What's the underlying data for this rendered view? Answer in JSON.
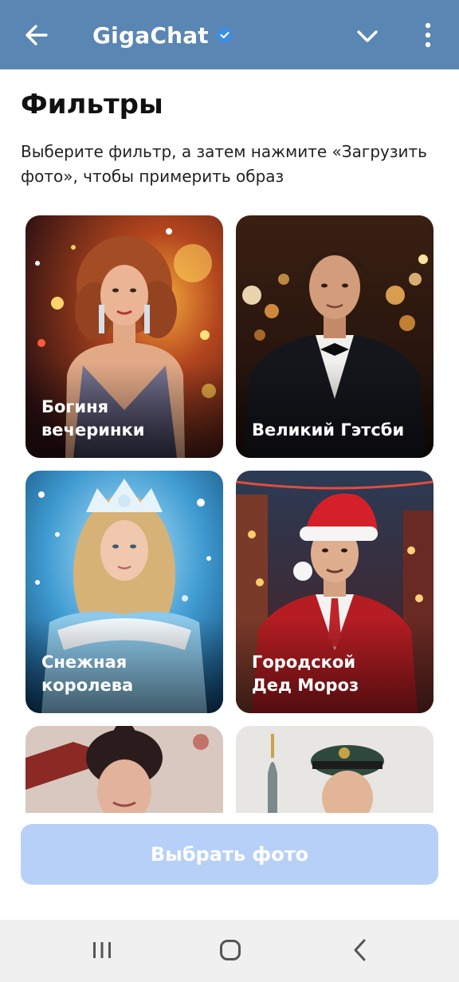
{
  "colors": {
    "header_bg": "#5a86b3",
    "verified": "#3a8ee6",
    "button_bg": "#b7d0f7",
    "navbar_bg": "#f0f0f0"
  },
  "header": {
    "title": "GigaChat",
    "back_icon": "arrow-left-icon",
    "verified_icon": "verified-badge-icon",
    "dropdown_icon": "chevron-down-icon",
    "more_icon": "more-vertical-icon"
  },
  "page": {
    "title": "Фильтры",
    "description": "Выберите фильтр, а затем нажмите «Загрузить фото», чтобы примерить образ"
  },
  "filters": [
    {
      "label": "Богиня\nвечеринки"
    },
    {
      "label": "Великий Гэтсби"
    },
    {
      "label": "Снежная\nкоролева"
    },
    {
      "label": "Городской\nДед Мороз"
    },
    {
      "label": ""
    },
    {
      "label": ""
    }
  ],
  "primary_button": {
    "label": "Выбрать фото"
  },
  "system_nav": {
    "recents_icon": "recent-apps-icon",
    "home_icon": "home-icon",
    "back_icon": "back-icon"
  }
}
